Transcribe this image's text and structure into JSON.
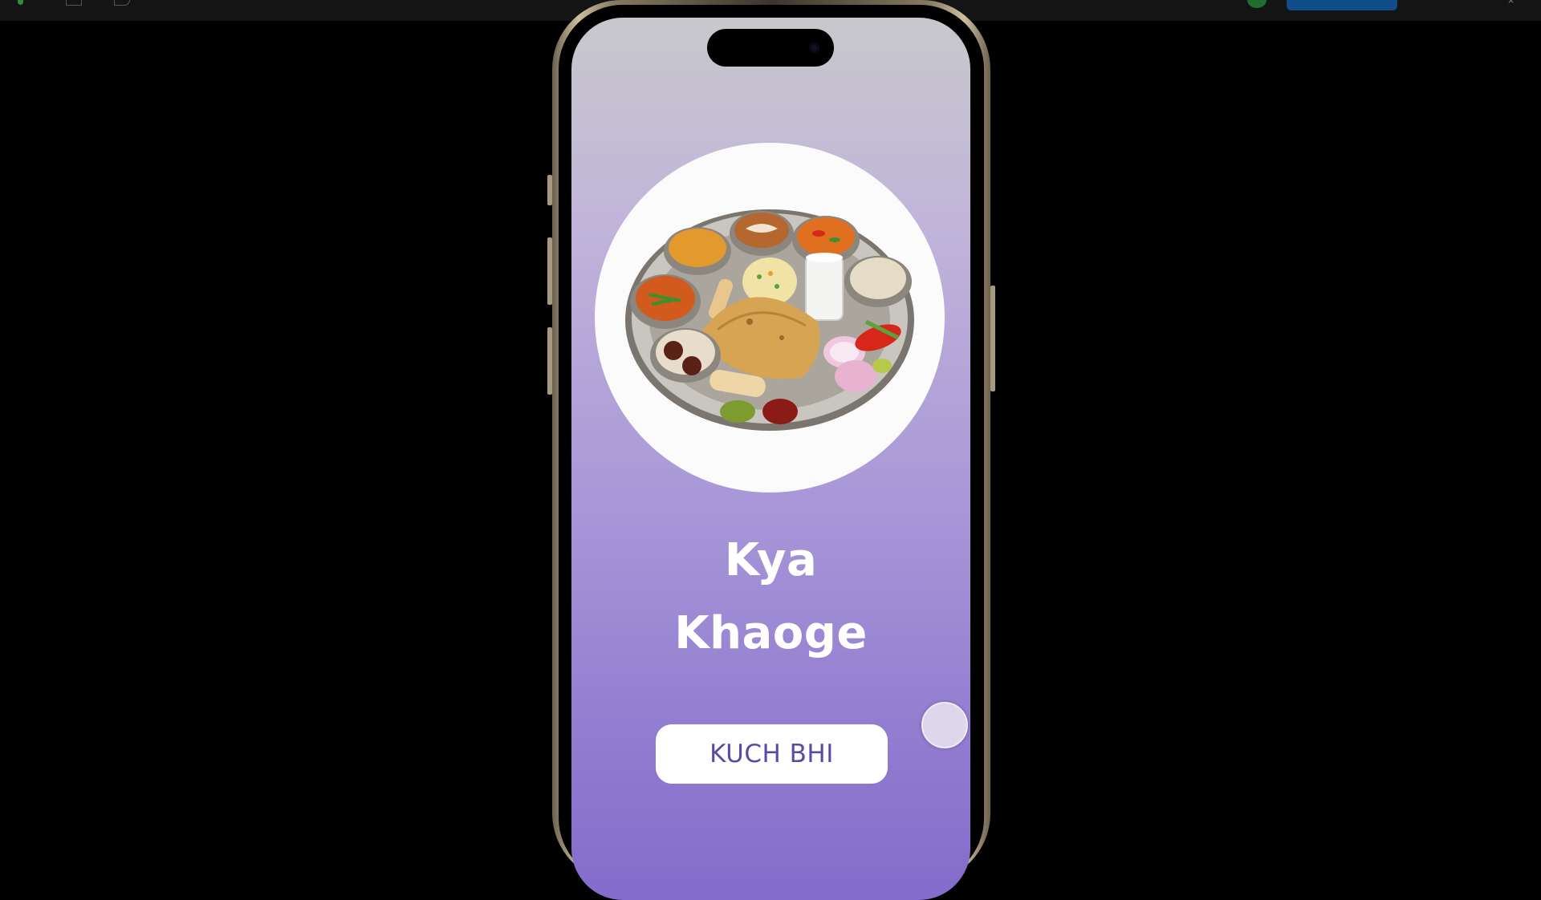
{
  "app": {
    "title_line1": "Kya",
    "title_line2": "Khaoge",
    "button_label": "KUCH BHI",
    "image_label": "thali-plate-image"
  },
  "colors": {
    "screen_top": "#c8c8cc",
    "screen_bottom": "#836ccb",
    "button_text": "#5b4aa3",
    "title_text": "#ffffff"
  }
}
